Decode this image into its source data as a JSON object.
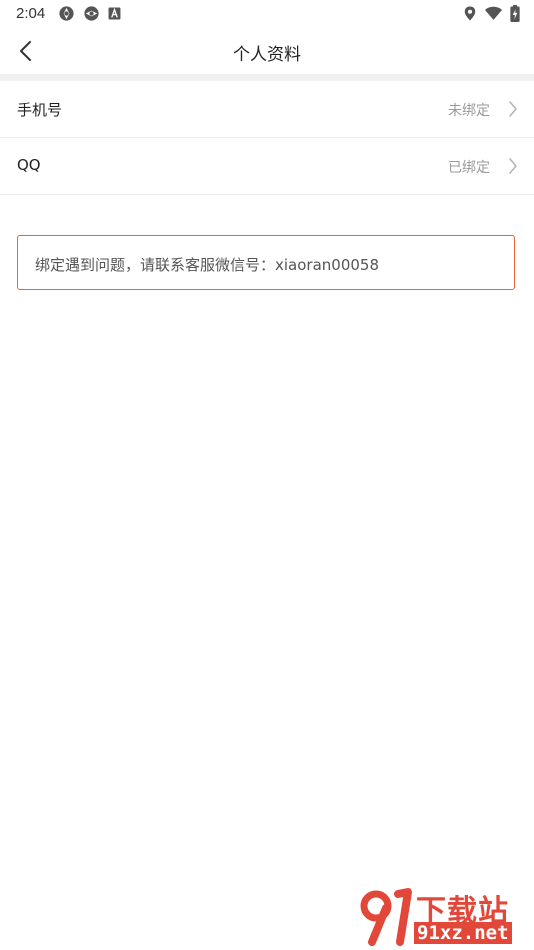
{
  "status_bar": {
    "time": "2:04"
  },
  "header": {
    "title": "个人资料"
  },
  "rows": [
    {
      "label": "手机号",
      "value": "未绑定"
    },
    {
      "label": "QQ",
      "value": "已绑定"
    }
  ],
  "notice": {
    "text": "绑定遇到问题，请联系客服微信号：xiaoran00058"
  },
  "watermark": {
    "text_top": "下载站",
    "text_bottom": "91xz.net"
  },
  "colors": {
    "accent": "#e8643a",
    "watermark": "#e2483a",
    "divider": "#f1f1f1",
    "muted_text": "#9a9a9a"
  }
}
